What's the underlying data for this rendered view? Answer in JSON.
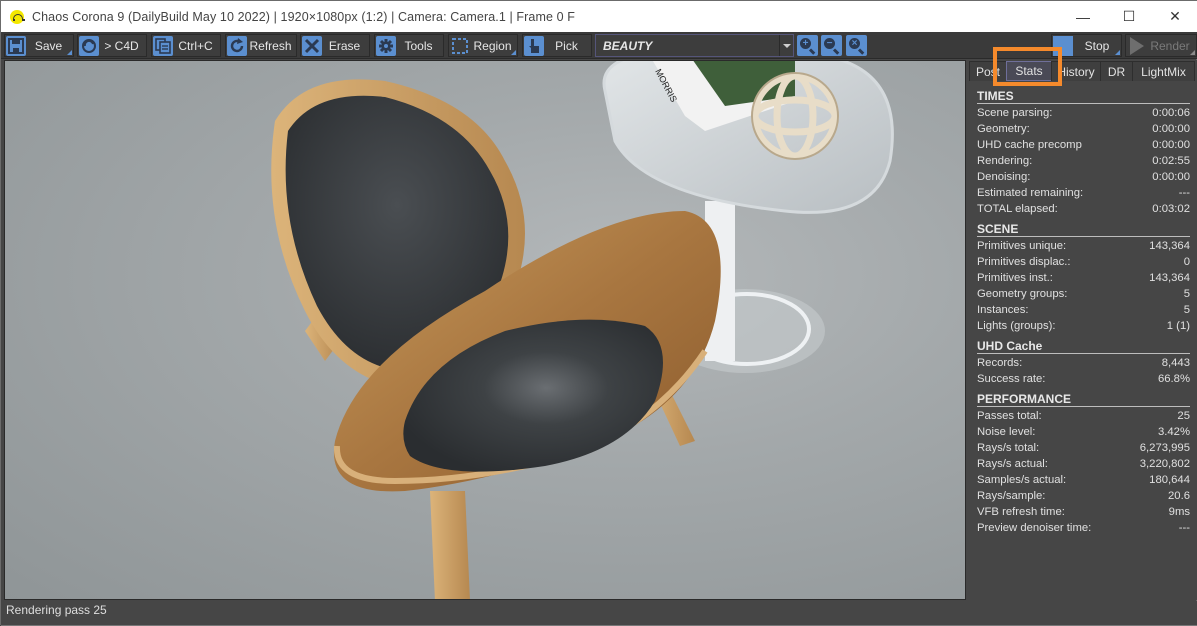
{
  "window": {
    "title": "Chaos Corona 9 (DailyBuild May 10 2022) | 1920×1080px (1:2) | Camera: Camera.1 | Frame 0 F",
    "controls": {
      "minimize": "—",
      "maximize": "☐",
      "close": "✕"
    }
  },
  "toolbar": {
    "save": "Save",
    "to_c4d": "> C4D",
    "copy": "Ctrl+C",
    "refresh": "Refresh",
    "erase": "Erase",
    "tools": "Tools",
    "region": "Region",
    "pick": "Pick",
    "render_pass": "BEAUTY",
    "stop": "Stop",
    "render": "Render"
  },
  "tabs": [
    {
      "label": "Post",
      "active": false
    },
    {
      "label": "Stats",
      "active": true
    },
    {
      "label": "History",
      "active": false
    },
    {
      "label": "DR",
      "active": false
    },
    {
      "label": "LightMix",
      "active": false
    }
  ],
  "stats": {
    "times": {
      "title": "TIMES",
      "rows": [
        {
          "label": "Scene parsing:",
          "value": "0:00:06"
        },
        {
          "label": "Geometry:",
          "value": "0:00:00"
        },
        {
          "label": "UHD cache precomp",
          "value": "0:00:00"
        },
        {
          "label": "Rendering:",
          "value": "0:02:55"
        },
        {
          "label": "Denoising:",
          "value": "0:00:00"
        },
        {
          "label": "Estimated remaining:",
          "value": "---"
        },
        {
          "label": "TOTAL elapsed:",
          "value": "0:03:02"
        }
      ]
    },
    "scene": {
      "title": "SCENE",
      "rows": [
        {
          "label": "Primitives unique:",
          "value": "143,364"
        },
        {
          "label": "Primitives displac.:",
          "value": "0"
        },
        {
          "label": "Primitives inst.:",
          "value": "143,364"
        },
        {
          "label": "Geometry groups:",
          "value": "5"
        },
        {
          "label": "Instances:",
          "value": "5"
        },
        {
          "label": "Lights (groups):",
          "value": "1 (1)"
        }
      ]
    },
    "uhd_cache": {
      "title": "UHD Cache",
      "rows": [
        {
          "label": "Records:",
          "value": "8,443"
        },
        {
          "label": "Success rate:",
          "value": "66.8%"
        }
      ]
    },
    "performance": {
      "title": "PERFORMANCE",
      "rows": [
        {
          "label": "Passes total:",
          "value": "25"
        },
        {
          "label": "Noise level:",
          "value": "3.42%"
        },
        {
          "label": "Rays/s total:",
          "value": "6,273,995"
        },
        {
          "label": "Rays/s actual:",
          "value": "3,220,802"
        },
        {
          "label": "Samples/s actual:",
          "value": "180,644"
        },
        {
          "label": "Rays/sample:",
          "value": "20.6"
        },
        {
          "label": "VFB refresh time:",
          "value": "9ms"
        },
        {
          "label": "Preview denoiser time:",
          "value": "---"
        }
      ]
    }
  },
  "render_image": {
    "description": "Rendered scene: wooden shell lounge chair with dark fabric cushions beside a white side table with books and a wooden decorative sphere",
    "book_title": "MORRIS"
  },
  "status": "Rendering pass 25",
  "colors": {
    "accent_blue": "#5b8fd0",
    "highlight_orange": "#f58a2c",
    "panel_bg": "#464646"
  }
}
